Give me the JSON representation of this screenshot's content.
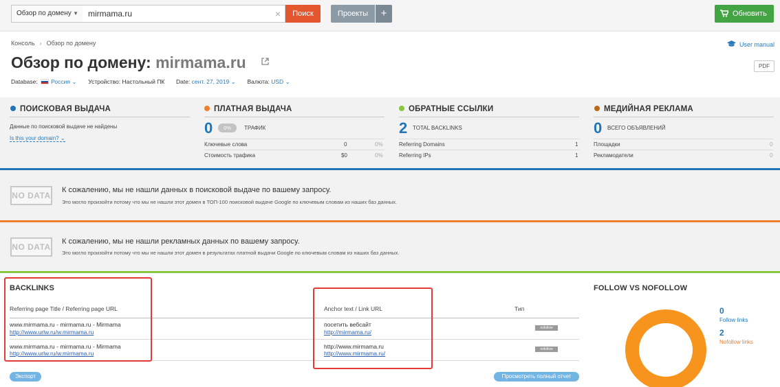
{
  "toolbar": {
    "db_select": "Обзор по домену",
    "search_value": "mirmama.ru",
    "search_button": "Поиск",
    "projects_button": "Проекты",
    "plus_button": "+",
    "update_button": "Обновить"
  },
  "breadcrumb": {
    "root": "Консоль",
    "current": "Обзор по домену"
  },
  "user_manual": "User manual",
  "page": {
    "title_prefix": "Обзор по домену:",
    "domain": "mirmama.ru",
    "pdf": "PDF"
  },
  "meta": {
    "database_label": "Database:",
    "database_value": "Россия",
    "device_label": "Устройство:",
    "device_value": "Настольный ПК",
    "date_label": "Date:",
    "date_value": "сент. 27, 2019",
    "currency_label": "Валюта:",
    "currency_value": "USD"
  },
  "overview": {
    "organic": {
      "title": "ПОИСКОВАЯ ВЫДАЧА",
      "no_data": "Данные по поисковой выдаче не найдены",
      "link": "Is this your domain?"
    },
    "paid": {
      "title": "ПЛАТНАЯ ВЫДАЧА",
      "value": "0",
      "badge": "0%",
      "label": "ТРАФИК",
      "rows": [
        {
          "label": "Ключевые слова",
          "value": "0",
          "pct": "0%"
        },
        {
          "label": "Стоимость трафика",
          "value": "$0",
          "pct": "0%"
        }
      ]
    },
    "backlinks": {
      "title": "ОБРАТНЫЕ ССЫЛКИ",
      "value": "2",
      "label": "TOTAL BACKLINKS",
      "rows": [
        {
          "label": "Referring Domains",
          "value": "1"
        },
        {
          "label": "Referring IPs",
          "value": "1"
        }
      ]
    },
    "display": {
      "title": "МЕДИЙНАЯ РЕКЛАМА",
      "value": "0",
      "label": "ВСЕГО ОБЪЯВЛЕНИЙ",
      "rows": [
        {
          "label": "Площадки",
          "value": "0"
        },
        {
          "label": "Рекламодатели",
          "value": "0"
        }
      ]
    }
  },
  "nodata": {
    "badge": "NO DATA",
    "organic_title": "К сожалению, мы не нашли данных в поисковой выдаче по вашему запросу.",
    "organic_sub": "Это могло произойти потому что мы не нашли этот домен в ТОП-100 поисковой выдаче Google по ключевым словам из наших баз данных.",
    "paid_title": "К сожалению, мы не нашли рекламных данных по вашему запросу.",
    "paid_sub": "Это могло произойти потому что мы не нашли этот домен в результатах платной выдачи Google по ключевым словам из наших баз данных."
  },
  "backlinks_table": {
    "title": "BACKLINKS",
    "col_ref": "Referring page Title / Referring page URL",
    "col_anchor": "Anchor text / Link URL",
    "col_type": "Тип",
    "rows": [
      {
        "ref_title": "www.mirmama.ru - mirmama.ru - Mirmama",
        "ref_url": "http://www.urlw.ru/w.mirmama.ru",
        "anchor": "посетить вебсайт",
        "anchor_url": "http://mirmama.ru/",
        "type": "nofollow"
      },
      {
        "ref_title": "www.mirmama.ru - mirmama.ru - Mirmama",
        "ref_url": "http://www.urlw.ru/w.mirmama.ru",
        "anchor": "http://www.mirmama.ru",
        "anchor_url": "http://www.mirmama.ru/",
        "type": "nofollow"
      }
    ],
    "export_button": "Экспорт",
    "full_report_button": "Просмотреть полный отчет"
  },
  "follow_nofollow": {
    "title": "FOLLOW VS NOFOLLOW",
    "follow_value": "0",
    "follow_label": "Follow links",
    "nofollow_value": "2",
    "nofollow_label": "Nofollow links",
    "follow_share": 0,
    "nofollow_share": 1
  },
  "colors": {
    "organic": "#1f75b7",
    "paid": "#f07f2a",
    "backlinks": "#8ac53e",
    "display": "#b86a1a",
    "donut": "#f7941d",
    "search_button": "#e4572e",
    "update_button": "#43a443",
    "highlight_box": "#e53935"
  }
}
